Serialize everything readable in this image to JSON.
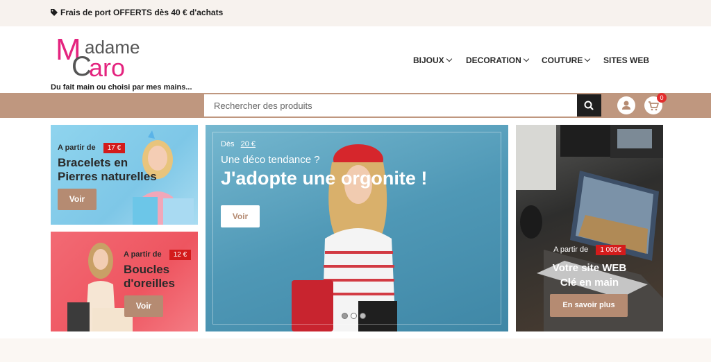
{
  "topbar": {
    "promo": "Frais de port OFFERTS dès 40 € d'achats",
    "icon": "tag-icon"
  },
  "brand": {
    "logo_text_1": "M",
    "logo_text_2": "adame",
    "logo_text_3": "C",
    "logo_text_4": "aro",
    "tagline": "Du fait main ou choisi par mes mains...",
    "colors": {
      "pink": "#e4247f",
      "grey": "#555555"
    }
  },
  "nav": {
    "items": [
      {
        "label": "BIJOUX",
        "dropdown": true
      },
      {
        "label": "DECORATION",
        "dropdown": true
      },
      {
        "label": "COUTURE",
        "dropdown": true
      },
      {
        "label": "SITES WEB",
        "dropdown": false
      }
    ]
  },
  "search": {
    "placeholder": "Rechercher des produits",
    "icon": "search-icon"
  },
  "account": {
    "icon": "user-icon"
  },
  "cart": {
    "icon": "cart-icon",
    "count": "0"
  },
  "banners": {
    "bracelets": {
      "from": "A partir de",
      "price": "17 €",
      "title_1": "Bracelets en",
      "title_2": "Pierres naturelles",
      "button": "Voir"
    },
    "earrings": {
      "from": "A partir de",
      "price": "12 €",
      "title_1": "Boucles",
      "title_2": "d'oreilles",
      "button": "Voir"
    },
    "orgonite": {
      "from": "Dès",
      "price": "20 €",
      "subtitle": "Une déco tendance ?",
      "title": "J'adopte une orgonite !",
      "button": "Voir",
      "slides": 3,
      "active_slide": 1
    },
    "website": {
      "from": "A partir de",
      "price": "1 000€",
      "title_1": "Votre site WEB",
      "title_2": "Clé en main",
      "button": "En savoir plus"
    }
  },
  "colors": {
    "accent": "#bf977f",
    "button": "#b58b72",
    "price_red": "#d31b1b",
    "topbar_bg": "#f7f2ee"
  }
}
